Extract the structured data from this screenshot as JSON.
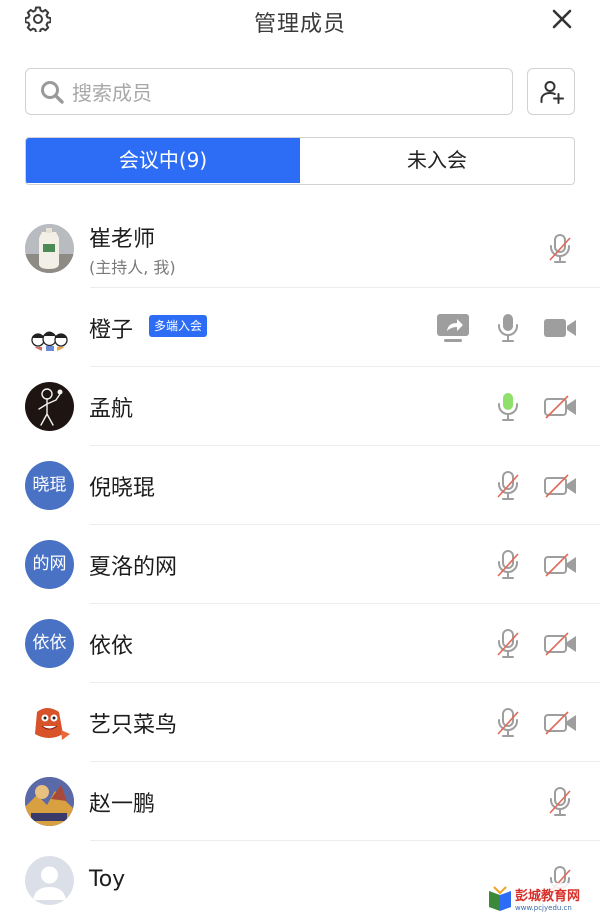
{
  "header": {
    "title": "管理成员",
    "settings_icon": "gear-icon",
    "close_icon": "close-icon"
  },
  "search": {
    "placeholder": "搜索成员",
    "value": "",
    "icon": "search-icon"
  },
  "invite": {
    "icon": "add-user-icon"
  },
  "tabs": [
    {
      "label": "会议中(9)",
      "active": true
    },
    {
      "label": "未入会",
      "active": false
    }
  ],
  "colors": {
    "accent": "#2d6df6",
    "avatar_bg": "#4a72c4",
    "mic_active": "#8fe06a",
    "muted_slash": "#e06a5a",
    "icon_gray": "#9e9e9e"
  },
  "members": [
    {
      "name": "崔老师",
      "sub": "(主持人, 我)",
      "avatar": "photo-avatar",
      "mic": "muted",
      "camera": null,
      "share": false,
      "badge": ""
    },
    {
      "name": "橙子",
      "sub": "",
      "avatar": "cartoon-avatar",
      "mic": "on",
      "camera": "on",
      "share": true,
      "badge": "多端入会"
    },
    {
      "name": "孟航",
      "sub": "",
      "avatar": "sketch-avatar",
      "mic": "speaking",
      "camera": "off",
      "share": false,
      "badge": ""
    },
    {
      "name": "倪晓琨",
      "sub": "",
      "avatar_text": "晓琨",
      "mic": "muted",
      "camera": "off",
      "share": false,
      "badge": ""
    },
    {
      "name": "夏洛的网",
      "sub": "",
      "avatar_text": "的网",
      "mic": "muted",
      "camera": "off",
      "share": false,
      "badge": ""
    },
    {
      "name": "依依",
      "sub": "",
      "avatar_text": "依依",
      "mic": "muted",
      "camera": "off",
      "share": false,
      "badge": ""
    },
    {
      "name": "艺只菜鸟",
      "sub": "",
      "avatar": "cartoon-avatar",
      "mic": "muted",
      "camera": "off",
      "share": false,
      "badge": ""
    },
    {
      "name": "赵一鹏",
      "sub": "",
      "avatar": "photo-avatar",
      "mic": "muted",
      "camera": null,
      "share": false,
      "badge": ""
    },
    {
      "name": "Toy",
      "sub": "",
      "avatar": "default-avatar",
      "mic": "muted",
      "camera": null,
      "share": false,
      "badge": ""
    }
  ],
  "watermark": {
    "text": "彭城教育网",
    "url_text": "www.pcjyedu.cn"
  }
}
